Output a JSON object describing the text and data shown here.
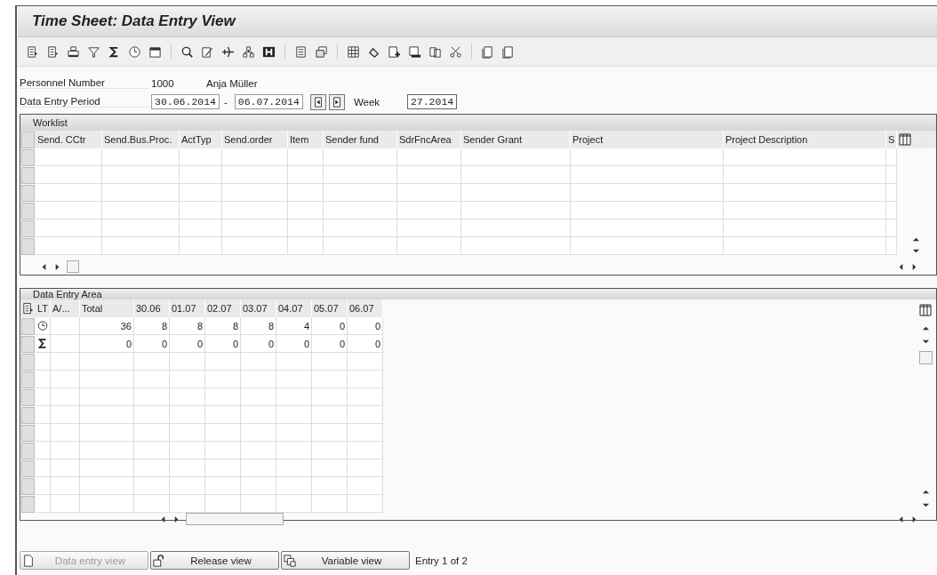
{
  "window": {
    "title": "Time Sheet: Data Entry View"
  },
  "header": {
    "personnel_label": "Personnel Number",
    "personnel_number": "1000",
    "employee_name": "Anja Müller",
    "period_label": "Data Entry Period",
    "period_from": "30.06.2014",
    "period_separator": "-",
    "period_to": "06.07.2014",
    "week_label": "Week",
    "week": "27.2014"
  },
  "worklist": {
    "title": "Worklist",
    "columns": [
      "Send. CCtr",
      "Send.Bus.Proc.",
      "ActTyp",
      "Send.order",
      "Item",
      "Sender fund",
      "SdrFncArea",
      "Sender Grant",
      "Project",
      "Project Description",
      "S"
    ]
  },
  "data_entry": {
    "title": "Data Entry Area",
    "columns": [
      "LT",
      "A/...",
      "Total",
      "30.06",
      "01.07",
      "02.07",
      "03.07",
      "04.07",
      "05.07",
      "06.07"
    ],
    "rows": [
      {
        "kind": "clock",
        "cells": [
          "36",
          "8",
          "8",
          "8",
          "8",
          "4",
          "0",
          "0"
        ]
      },
      {
        "kind": "sum",
        "cells": [
          "0",
          "0",
          "0",
          "0",
          "0",
          "0",
          "0",
          "0"
        ]
      }
    ]
  },
  "buttons": [
    {
      "label": "Data entry view",
      "kind": "page",
      "disabled": true
    },
    {
      "label": "Release view",
      "kind": "lock",
      "disabled": false
    },
    {
      "label": "Variable view",
      "kind": "copy",
      "disabled": false
    }
  ],
  "entry_info": "Entry 1 of 2"
}
